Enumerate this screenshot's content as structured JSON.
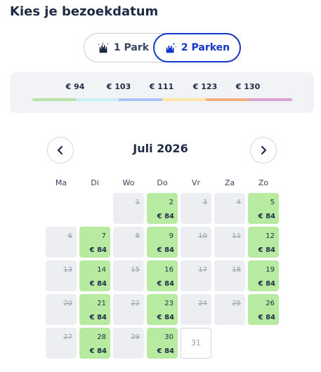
{
  "title": "Kies je bezoekdatum",
  "park_toggle": {
    "options": [
      {
        "label": "1 Park",
        "icon": "castle-icon"
      },
      {
        "label": "2 Parken",
        "icon": "castle-sparkle-icon",
        "selected": true
      }
    ]
  },
  "price_legend": {
    "labels": [
      "€ 94",
      "€ 103",
      "€ 111",
      "€ 123",
      "€ 130"
    ],
    "colors": [
      "#b7e4a5",
      "#c7eff5",
      "#a8c3f5",
      "#fde7a8",
      "#f6b07e",
      "#d9a2d0"
    ]
  },
  "calendar": {
    "month_label": "Juli 2026",
    "prev_icon": "chevron-left-icon",
    "next_icon": "chevron-right-icon",
    "weekdays": [
      "Ma",
      "Di",
      "Wo",
      "Do",
      "Vr",
      "Za",
      "Zo"
    ],
    "colors": {
      "available": "#b7eba1",
      "unavailable": "#eceef1",
      "accent": "#1438c8"
    },
    "days": [
      {
        "day": "1",
        "status": "unavailable",
        "col": 2,
        "row": 0
      },
      {
        "day": "2",
        "status": "available",
        "price": "€ 84",
        "col": 3,
        "row": 0
      },
      {
        "day": "3",
        "status": "unavailable",
        "col": 4,
        "row": 0
      },
      {
        "day": "4",
        "status": "unavailable",
        "col": 5,
        "row": 0
      },
      {
        "day": "5",
        "status": "available",
        "price": "€ 84",
        "col": 6,
        "row": 0
      },
      {
        "day": "6",
        "status": "unavailable",
        "col": 0,
        "row": 1
      },
      {
        "day": "7",
        "status": "available",
        "price": "€ 84",
        "col": 1,
        "row": 1
      },
      {
        "day": "8",
        "status": "unavailable",
        "col": 2,
        "row": 1
      },
      {
        "day": "9",
        "status": "available",
        "price": "€ 84",
        "col": 3,
        "row": 1
      },
      {
        "day": "10",
        "status": "unavailable",
        "col": 4,
        "row": 1
      },
      {
        "day": "11",
        "status": "unavailable",
        "col": 5,
        "row": 1
      },
      {
        "day": "12",
        "status": "available",
        "price": "€ 84",
        "col": 6,
        "row": 1
      },
      {
        "day": "13",
        "status": "unavailable",
        "col": 0,
        "row": 2
      },
      {
        "day": "14",
        "status": "available",
        "price": "€ 84",
        "col": 1,
        "row": 2
      },
      {
        "day": "15",
        "status": "unavailable",
        "col": 2,
        "row": 2
      },
      {
        "day": "16",
        "status": "available",
        "price": "€ 84",
        "col": 3,
        "row": 2
      },
      {
        "day": "17",
        "status": "unavailable",
        "col": 4,
        "row": 2
      },
      {
        "day": "18",
        "status": "unavailable",
        "col": 5,
        "row": 2
      },
      {
        "day": "19",
        "status": "available",
        "price": "€ 84",
        "col": 6,
        "row": 2
      },
      {
        "day": "20",
        "status": "unavailable",
        "col": 0,
        "row": 3
      },
      {
        "day": "21",
        "status": "available",
        "price": "€ 84",
        "col": 1,
        "row": 3
      },
      {
        "day": "22",
        "status": "unavailable",
        "col": 2,
        "row": 3
      },
      {
        "day": "23",
        "status": "available",
        "price": "€ 84",
        "col": 3,
        "row": 3
      },
      {
        "day": "24",
        "status": "unavailable",
        "col": 4,
        "row": 3
      },
      {
        "day": "25",
        "status": "unavailable",
        "col": 5,
        "row": 3
      },
      {
        "day": "26",
        "status": "available",
        "price": "€ 84",
        "col": 6,
        "row": 3
      },
      {
        "day": "27",
        "status": "unavailable",
        "col": 0,
        "row": 4
      },
      {
        "day": "28",
        "status": "available",
        "price": "€ 84",
        "col": 1,
        "row": 4
      },
      {
        "day": "29",
        "status": "unavailable",
        "col": 2,
        "row": 4
      },
      {
        "day": "30",
        "status": "available",
        "price": "€ 84",
        "col": 3,
        "row": 4
      },
      {
        "day": "31",
        "status": "empty",
        "col": 4,
        "row": 4
      }
    ]
  }
}
